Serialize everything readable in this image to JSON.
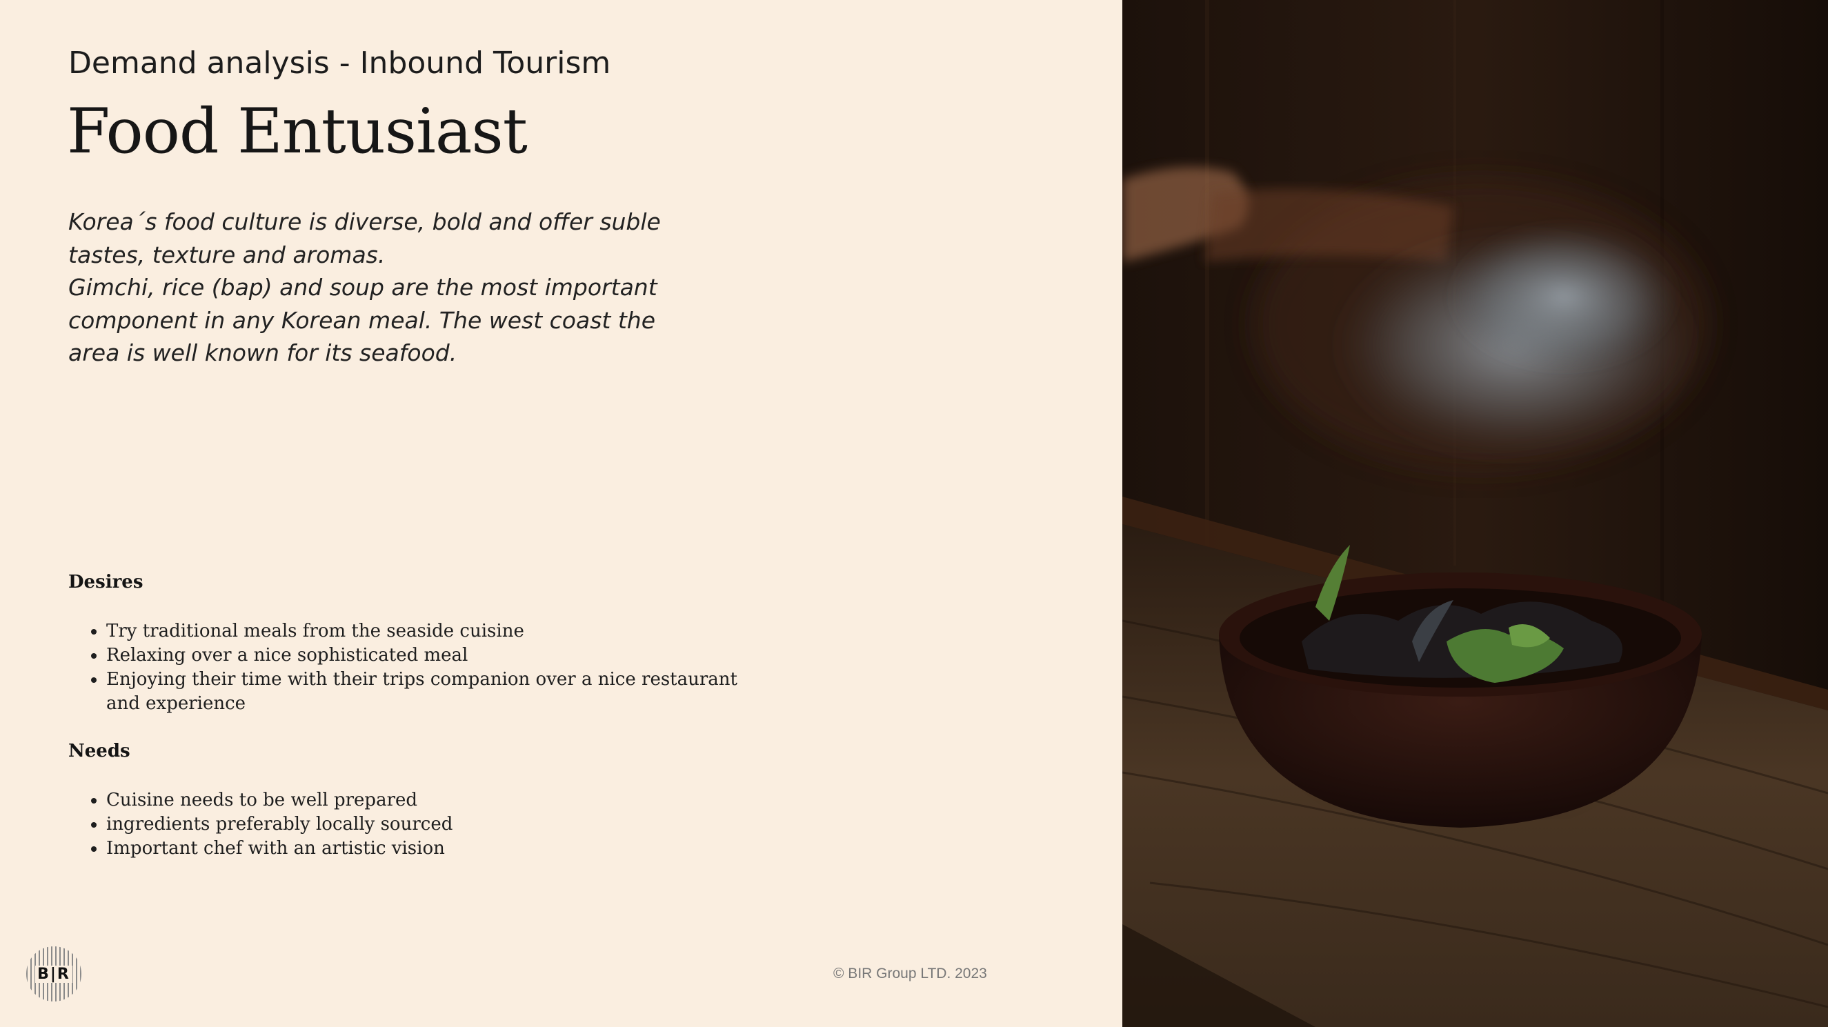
{
  "header": {
    "subtitle": "Demand analysis - Inbound Tourism",
    "title": "Food Entusiast"
  },
  "intro": {
    "paragraph1": "Korea´s food culture is diverse, bold and offer suble tastes, texture and aromas.",
    "paragraph2": "Gimchi, rice (bap) and soup are the most important component in any Korean meal.  The west coast the area is well known for its seafood."
  },
  "desires": {
    "heading": "Desires",
    "items": [
      "Try traditional meals from the seaside cuisine",
      "Relaxing over a nice sophisticated meal",
      "Enjoying their time with their trips companion over a nice restaurant and experience"
    ]
  },
  "needs": {
    "heading": "Needs",
    "items": [
      "Cuisine needs to be well prepared",
      "ingredients preferably locally sourced",
      "Important chef with an artistic vision"
    ]
  },
  "footer": {
    "copyright": "© BIR Group LTD. 2023",
    "logo_text": "B|R"
  },
  "colors": {
    "background": "#faeee0",
    "photo_dark": "#1a100b"
  }
}
